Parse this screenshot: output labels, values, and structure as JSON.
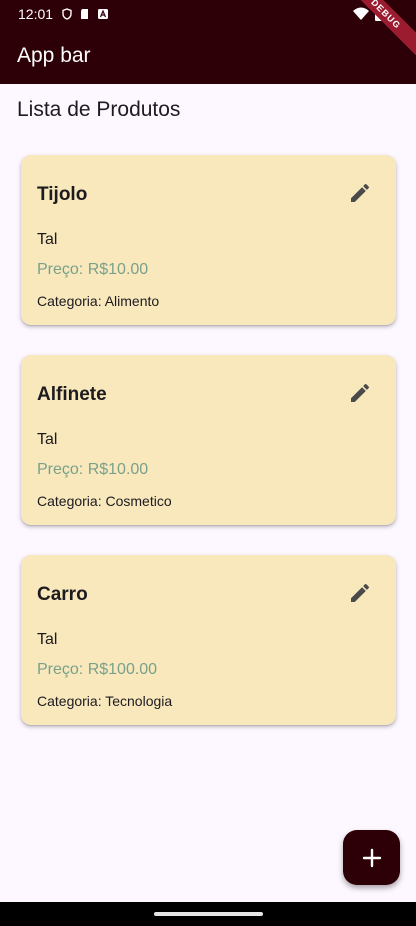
{
  "status": {
    "time": "12:01"
  },
  "appbar": {
    "title": "App bar",
    "debug_banner": "DEBUG"
  },
  "page": {
    "title": "Lista de Produtos"
  },
  "products": [
    {
      "name": "Tijolo",
      "description": "Tal",
      "price": "Preço: R$10.00",
      "category": "Categoria: Alimento"
    },
    {
      "name": "Alfinete",
      "description": "Tal",
      "price": "Preço: R$10.00",
      "category": "Categoria: Cosmetico"
    },
    {
      "name": "Carro",
      "description": "Tal",
      "price": "Preço: R$100.00",
      "category": "Categoria: Tecnologia"
    }
  ],
  "icons": {
    "edit": "pencil-icon",
    "add": "plus-icon"
  },
  "colors": {
    "bar": "#2d0007",
    "card": "#f8e8bc",
    "price": "#7aa08b",
    "background": "#fdf7ff"
  }
}
